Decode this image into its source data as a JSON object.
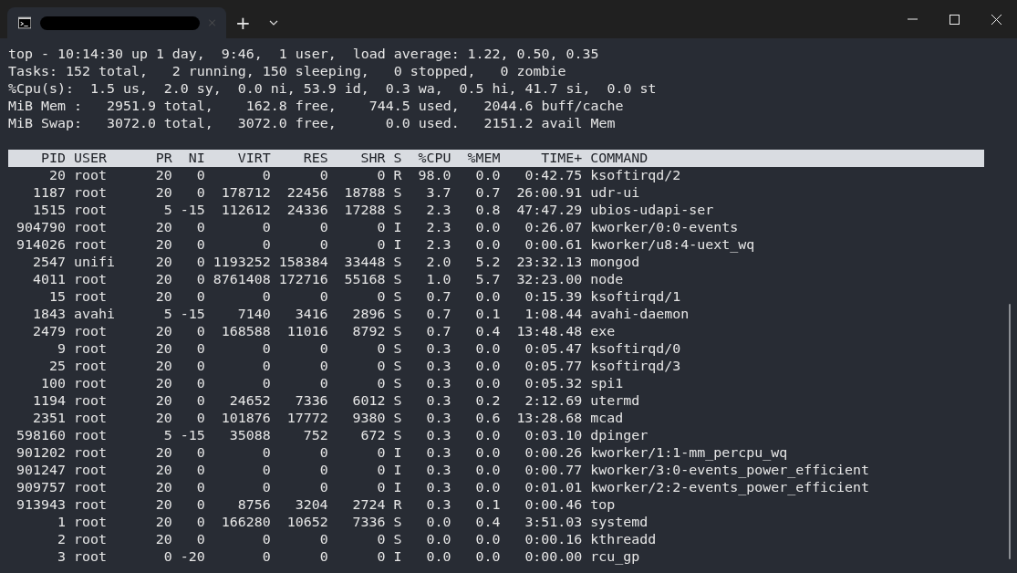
{
  "tab_bar": {
    "new_tab": "+"
  },
  "summary": [
    "top - 10:14:30 up 1 day,  9:46,  1 user,  load average: 1.22, 0.50, 0.35",
    "Tasks: 152 total,   2 running, 150 sleeping,   0 stopped,   0 zombie",
    "%Cpu(s):  1.5 us,  2.0 sy,  0.0 ni, 53.9 id,  0.3 wa,  0.5 hi, 41.7 si,  0.0 st",
    "MiB Mem :   2951.9 total,    162.8 free,    744.5 used,   2044.6 buff/cache",
    "MiB Swap:   3072.0 total,   3072.0 free,      0.0 used.   2151.2 avail Mem"
  ],
  "table": {
    "columns": [
      "PID",
      "USER",
      "PR",
      "NI",
      "VIRT",
      "RES",
      "SHR",
      "S",
      "%CPU",
      "%MEM",
      "TIME+",
      "COMMAND"
    ],
    "rows": [
      [
        "20",
        "root",
        "20",
        "0",
        "0",
        "0",
        "0",
        "R",
        "98.0",
        "0.0",
        "0:42.75",
        "ksoftirqd/2"
      ],
      [
        "1187",
        "root",
        "20",
        "0",
        "178712",
        "22456",
        "18788",
        "S",
        "3.7",
        "0.7",
        "26:00.91",
        "udr-ui"
      ],
      [
        "1515",
        "root",
        "5",
        "-15",
        "112612",
        "24336",
        "17288",
        "S",
        "2.3",
        "0.8",
        "47:47.29",
        "ubios-udapi-ser"
      ],
      [
        "904790",
        "root",
        "20",
        "0",
        "0",
        "0",
        "0",
        "I",
        "2.3",
        "0.0",
        "0:26.07",
        "kworker/0:0-events"
      ],
      [
        "914026",
        "root",
        "20",
        "0",
        "0",
        "0",
        "0",
        "I",
        "2.3",
        "0.0",
        "0:00.61",
        "kworker/u8:4-uext_wq"
      ],
      [
        "2547",
        "unifi",
        "20",
        "0",
        "1193252",
        "158384",
        "33448",
        "S",
        "2.0",
        "5.2",
        "23:32.13",
        "mongod"
      ],
      [
        "4011",
        "root",
        "20",
        "0",
        "8761408",
        "172716",
        "55168",
        "S",
        "1.0",
        "5.7",
        "32:23.00",
        "node"
      ],
      [
        "15",
        "root",
        "20",
        "0",
        "0",
        "0",
        "0",
        "S",
        "0.7",
        "0.0",
        "0:15.39",
        "ksoftirqd/1"
      ],
      [
        "1843",
        "avahi",
        "5",
        "-15",
        "7140",
        "3416",
        "2896",
        "S",
        "0.7",
        "0.1",
        "1:08.44",
        "avahi-daemon"
      ],
      [
        "2479",
        "root",
        "20",
        "0",
        "168588",
        "11016",
        "8792",
        "S",
        "0.7",
        "0.4",
        "13:48.48",
        "exe"
      ],
      [
        "9",
        "root",
        "20",
        "0",
        "0",
        "0",
        "0",
        "S",
        "0.3",
        "0.0",
        "0:05.47",
        "ksoftirqd/0"
      ],
      [
        "25",
        "root",
        "20",
        "0",
        "0",
        "0",
        "0",
        "S",
        "0.3",
        "0.0",
        "0:05.77",
        "ksoftirqd/3"
      ],
      [
        "100",
        "root",
        "20",
        "0",
        "0",
        "0",
        "0",
        "S",
        "0.3",
        "0.0",
        "0:05.32",
        "spi1"
      ],
      [
        "1194",
        "root",
        "20",
        "0",
        "24652",
        "7336",
        "6012",
        "S",
        "0.3",
        "0.2",
        "2:12.69",
        "utermd"
      ],
      [
        "2351",
        "root",
        "20",
        "0",
        "101876",
        "17772",
        "9380",
        "S",
        "0.3",
        "0.6",
        "13:28.68",
        "mcad"
      ],
      [
        "598160",
        "root",
        "5",
        "-15",
        "35088",
        "752",
        "672",
        "S",
        "0.3",
        "0.0",
        "0:03.10",
        "dpinger"
      ],
      [
        "901202",
        "root",
        "20",
        "0",
        "0",
        "0",
        "0",
        "I",
        "0.3",
        "0.0",
        "0:00.26",
        "kworker/1:1-mm_percpu_wq"
      ],
      [
        "901247",
        "root",
        "20",
        "0",
        "0",
        "0",
        "0",
        "I",
        "0.3",
        "0.0",
        "0:00.77",
        "kworker/3:0-events_power_efficient"
      ],
      [
        "909757",
        "root",
        "20",
        "0",
        "0",
        "0",
        "0",
        "I",
        "0.3",
        "0.0",
        "0:01.01",
        "kworker/2:2-events_power_efficient"
      ],
      [
        "913943",
        "root",
        "20",
        "0",
        "8756",
        "3204",
        "2724",
        "R",
        "0.3",
        "0.1",
        "0:00.46",
        "top"
      ],
      [
        "1",
        "root",
        "20",
        "0",
        "166280",
        "10652",
        "7336",
        "S",
        "0.0",
        "0.4",
        "3:51.03",
        "systemd"
      ],
      [
        "2",
        "root",
        "20",
        "0",
        "0",
        "0",
        "0",
        "S",
        "0.0",
        "0.0",
        "0:00.16",
        "kthreadd"
      ],
      [
        "3",
        "root",
        "0",
        "-20",
        "0",
        "0",
        "0",
        "I",
        "0.0",
        "0.0",
        "0:00.00",
        "rcu_gp"
      ]
    ]
  }
}
